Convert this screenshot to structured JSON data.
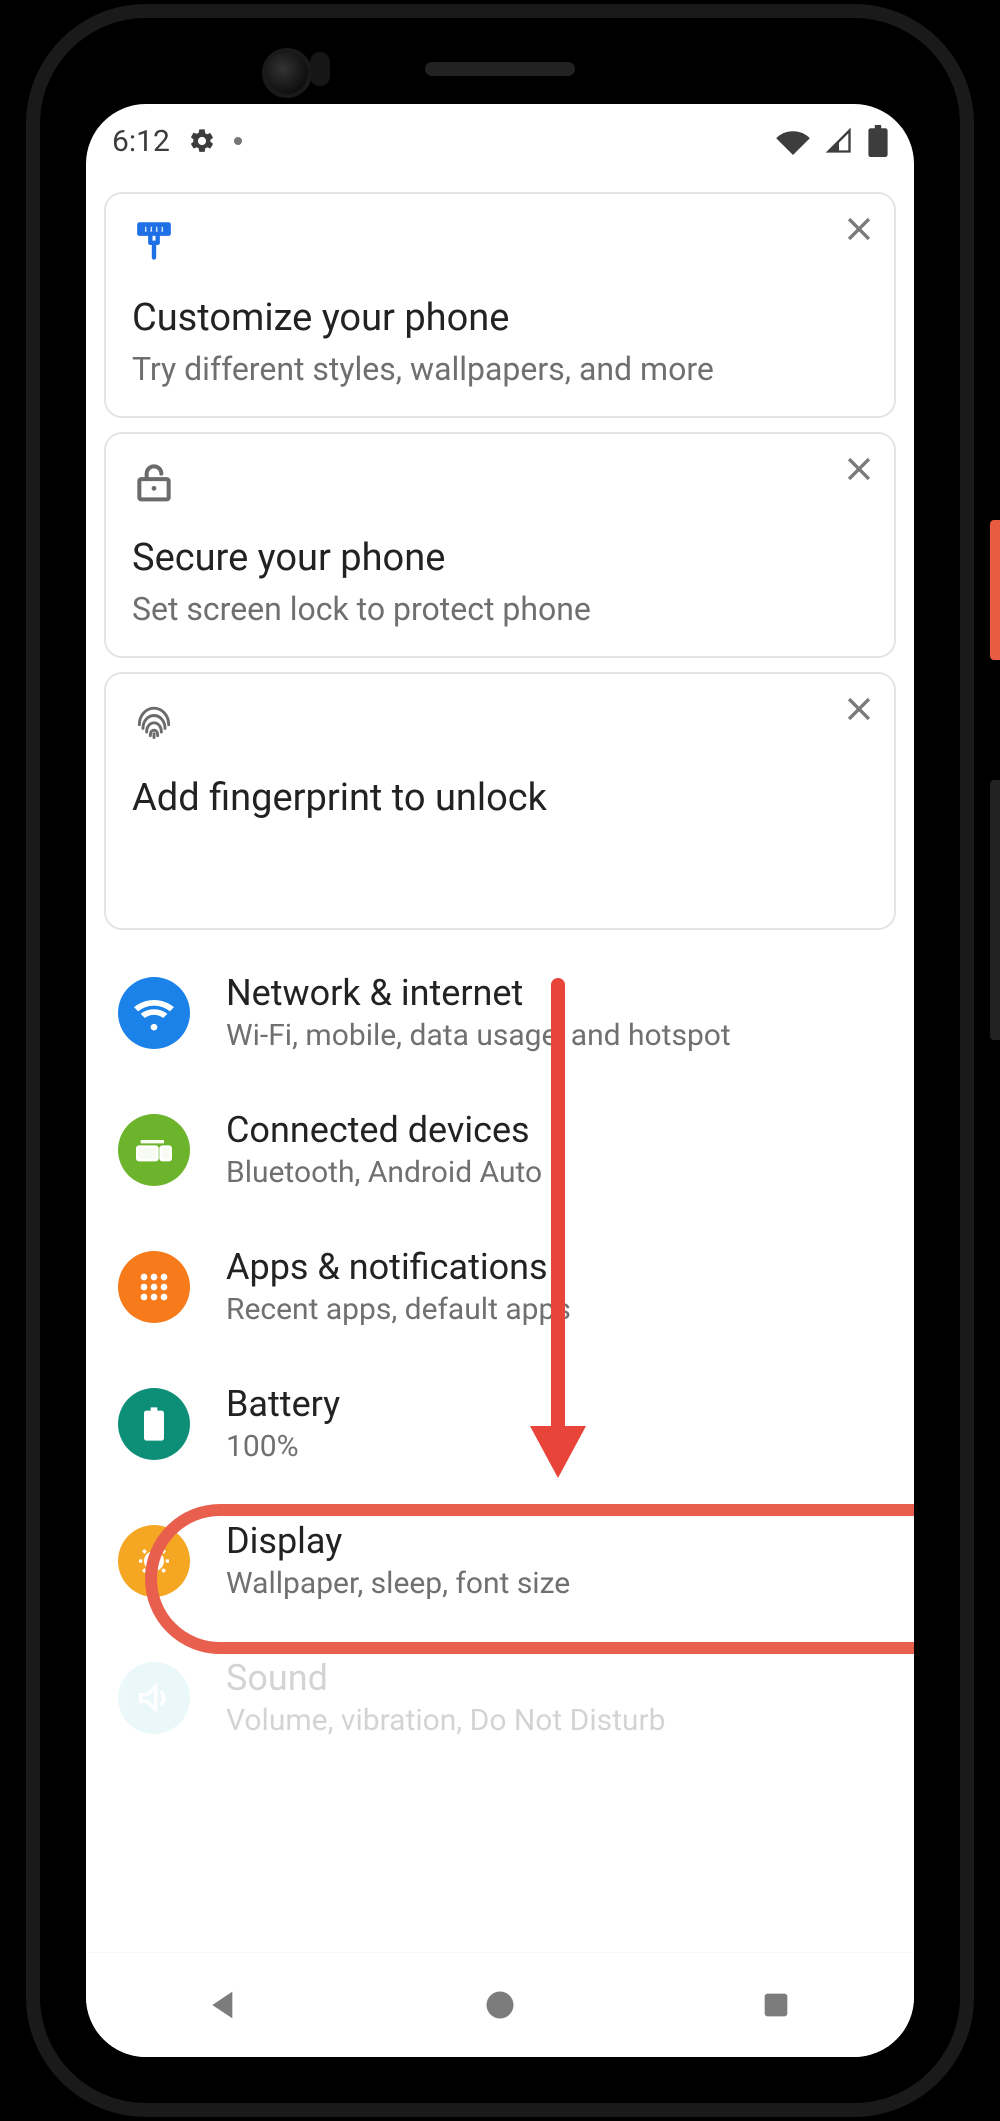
{
  "statusbar": {
    "time": "6:12"
  },
  "cards": [
    {
      "title": "Customize your phone",
      "subtitle": "Try different styles, wallpapers, and more"
    },
    {
      "title": "Secure your phone",
      "subtitle": "Set screen lock to protect phone"
    },
    {
      "title": "Add fingerprint to unlock",
      "subtitle": ""
    }
  ],
  "rows": [
    {
      "title": "Network & internet",
      "subtitle": "Wi-Fi, mobile, data usage, and hotspot"
    },
    {
      "title": "Connected devices",
      "subtitle": "Bluetooth, Android Auto"
    },
    {
      "title": "Apps & notifications",
      "subtitle": "Recent apps, default apps"
    },
    {
      "title": "Battery",
      "subtitle": "100%"
    },
    {
      "title": "Display",
      "subtitle": "Wallpaper, sleep, font size"
    },
    {
      "title": "Sound",
      "subtitle": "Volume, vibration, Do Not Disturb"
    }
  ],
  "annotation": {
    "highlightedRowIndex": 2
  }
}
